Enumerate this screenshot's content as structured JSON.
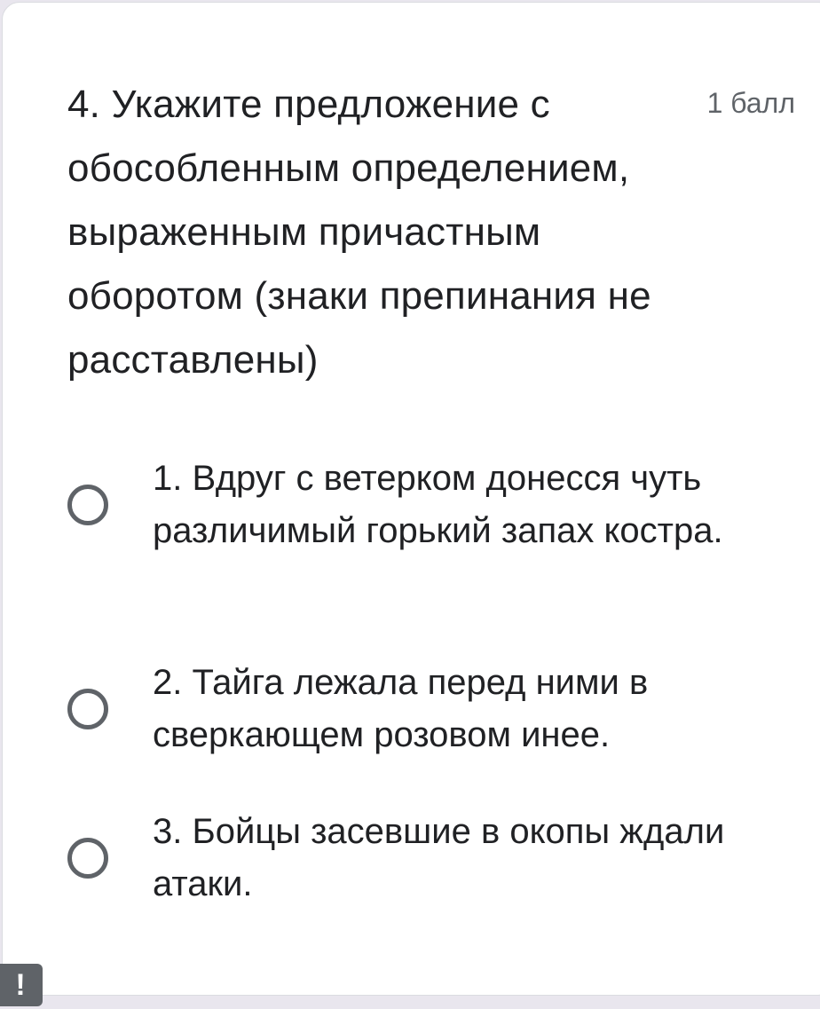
{
  "question": {
    "title": "4. Укажите предложение с обособленным определением, выраженным причастным оборотом (знаки препинания не расставлены)",
    "points": "1 балл"
  },
  "options": [
    {
      "label": "1. Вдруг с ветерком донесся чуть различимый горький запах костра."
    },
    {
      "label": "2. Тайга лежала перед ними в сверкающем розовом инее."
    },
    {
      "label": "3. Бойцы засевшие в окопы ждали атаки."
    }
  ],
  "badge": {
    "symbol": "!"
  },
  "colors": {
    "text": "#202124",
    "secondary": "#5f6368",
    "background": "#e9e6ee"
  }
}
